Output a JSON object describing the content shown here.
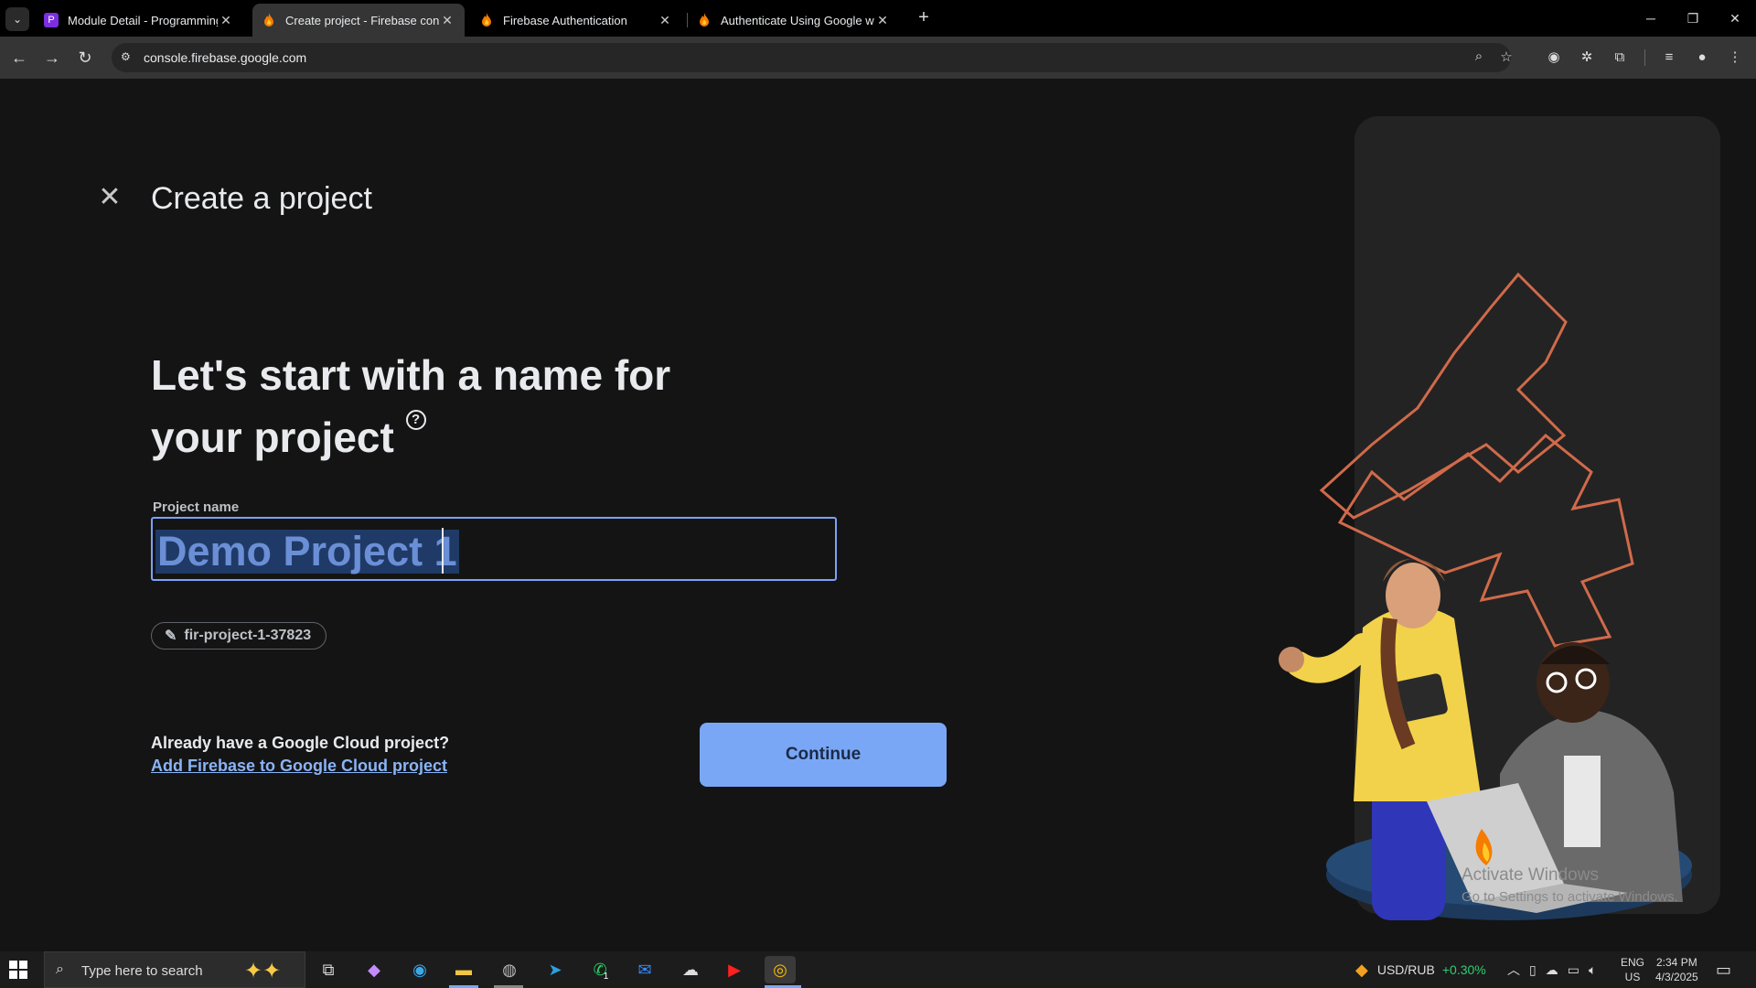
{
  "browser": {
    "tabs": [
      {
        "title": "Module Detail - Programming H",
        "favicon_color": "#7b2fe0",
        "favicon_glyph": "P"
      },
      {
        "title": "Create project - Firebase conso",
        "favicon_color": "#f57c00",
        "favicon_glyph": "firebase-flame-icon"
      },
      {
        "title": "Firebase Authentication",
        "favicon_color": "#f57c00",
        "favicon_glyph": "firebase-flame-icon"
      },
      {
        "title": "Authenticate Using Google with",
        "favicon_color": "#f57c00",
        "favicon_glyph": "firebase-flame-icon"
      }
    ],
    "url": "console.firebase.google.com"
  },
  "page": {
    "title": "Create a project",
    "headline_line1": "Let's start with a name for",
    "headline_line2": "your project",
    "help_glyph": "?",
    "project_name_label": "Project name",
    "project_name_value": "Demo Project 1",
    "project_id": "fir-project-1-37823",
    "cloud_question": "Already have a Google Cloud project?",
    "cloud_link": "Add Firebase to Google Cloud project",
    "continue_label": "Continue",
    "accent_color": "#7aa7f5"
  },
  "watermark": {
    "line1": "Activate Windows",
    "line2": "Go to Settings to activate Windows."
  },
  "taskbar": {
    "search_placeholder": "Type here to search",
    "whatsapp_badge": "1",
    "currency": "USD/RUB",
    "currency_change": "+0.30%",
    "lang1": "ENG",
    "lang2": "US",
    "time": "2:34 PM",
    "date": "4/3/2025"
  }
}
